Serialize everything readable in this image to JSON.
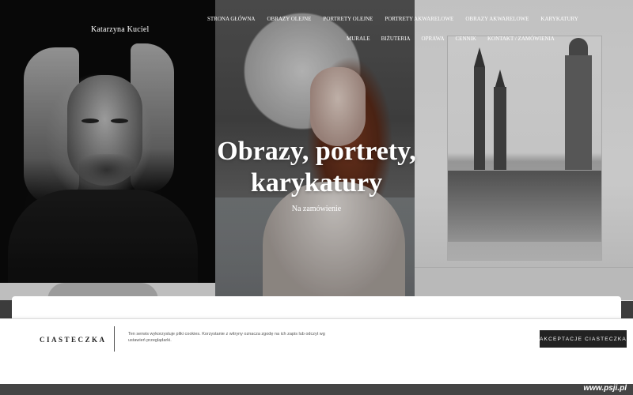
{
  "brand": {
    "name": "Katarzyna Kuciel"
  },
  "nav": {
    "row1": [
      "STRONA GŁÓWNA",
      "OBRAZY OLEJNE",
      "PORTRETY OLEJNE",
      "PORTRETY AKWARELOWE",
      "OBRAZY AKWARELOWE",
      "KARYKATURY"
    ],
    "row2": [
      "MURALE",
      "BIŻUTERIA",
      "OPRAWA",
      "CENNIK",
      "KONTAKT / ZAMÓWIENIA"
    ]
  },
  "hero": {
    "title_line1": "Obrazy, portrety,",
    "title_line2": "karykatury",
    "subtitle": "Na zamówienie"
  },
  "cookie": {
    "title": "CIASTECZKA",
    "text": "Ten serwis wykorzystuje pliki cookies. Korzystanie z witryny oznacza zgodę na ich zapis lub odczyt wg ustawień przeglądarki.",
    "accept_label": "AKCEPTACJE CIASTECZKA"
  },
  "watermark": "www.psji.pl",
  "colors": {
    "accent_dark": "#222222",
    "hero_text": "#ffffff",
    "footer": "#444444"
  }
}
